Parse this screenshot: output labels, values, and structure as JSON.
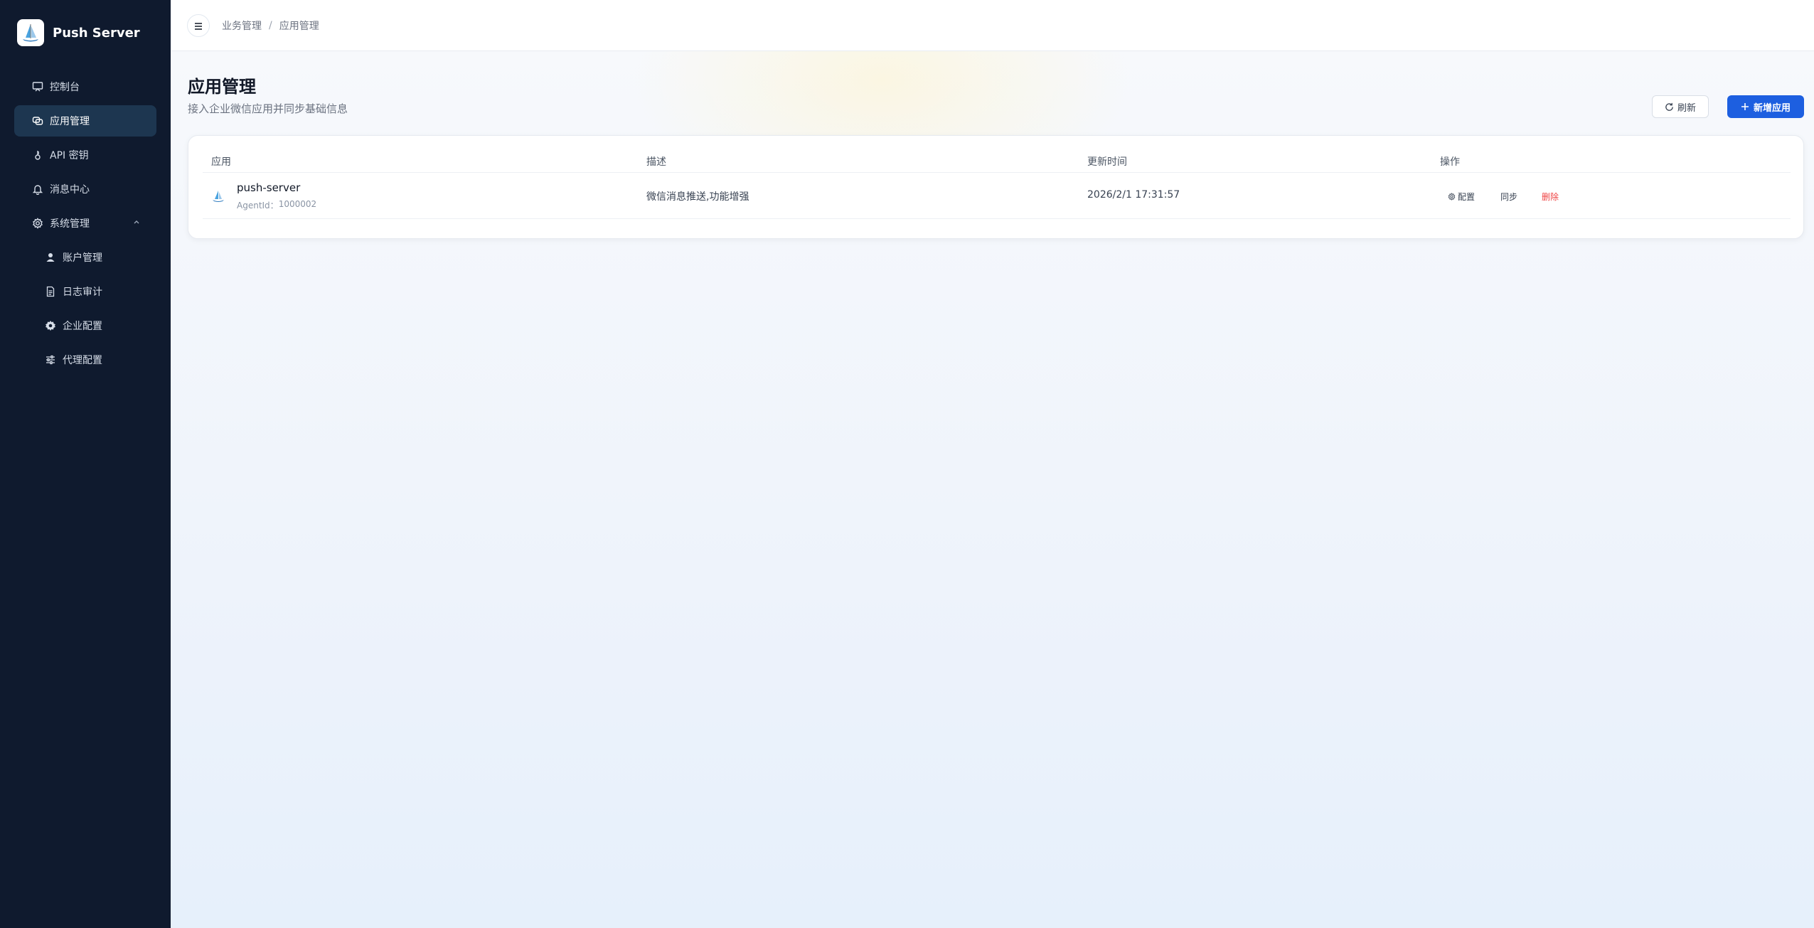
{
  "app": {
    "title": "Push Server"
  },
  "sidebar": {
    "items": [
      {
        "label": "控制台",
        "icon": "dashboard-icon"
      },
      {
        "label": "应用管理",
        "icon": "apps-icon",
        "active": true
      },
      {
        "label": "API 密钥",
        "icon": "key-icon"
      },
      {
        "label": "消息中心",
        "icon": "bell-icon"
      },
      {
        "label": "系统管理",
        "icon": "gear-icon",
        "expanded": true
      }
    ],
    "subitems": [
      {
        "label": "账户管理",
        "icon": "user-icon"
      },
      {
        "label": "日志审计",
        "icon": "document-icon"
      },
      {
        "label": "企业配置",
        "icon": "cog-icon"
      },
      {
        "label": "代理配置",
        "icon": "sliders-icon"
      }
    ]
  },
  "header": {
    "breadcrumb": [
      "业务管理",
      "应用管理"
    ],
    "separator": "/"
  },
  "main": {
    "title": "应用管理",
    "subtitle": "接入企业微信应用并同步基础信息",
    "refresh_label": "刷新",
    "add_label": "新增应用"
  },
  "table": {
    "columns": [
      "应用",
      "描述",
      "更新时间",
      "操作"
    ],
    "rows": [
      {
        "name": "push-server",
        "agent_label": "AgentId：",
        "agent_id": "1000002",
        "description": "微信消息推送,功能增强",
        "updated": "2026/2/1 17:31:57",
        "actions": {
          "config": "配置",
          "sync": "同步",
          "delete": "删除"
        }
      }
    ]
  },
  "colors": {
    "sidebar_bg": "#0f1a2e",
    "sidebar_active": "#1d3650",
    "primary": "#1d5fe0",
    "danger": "#ef4444"
  }
}
